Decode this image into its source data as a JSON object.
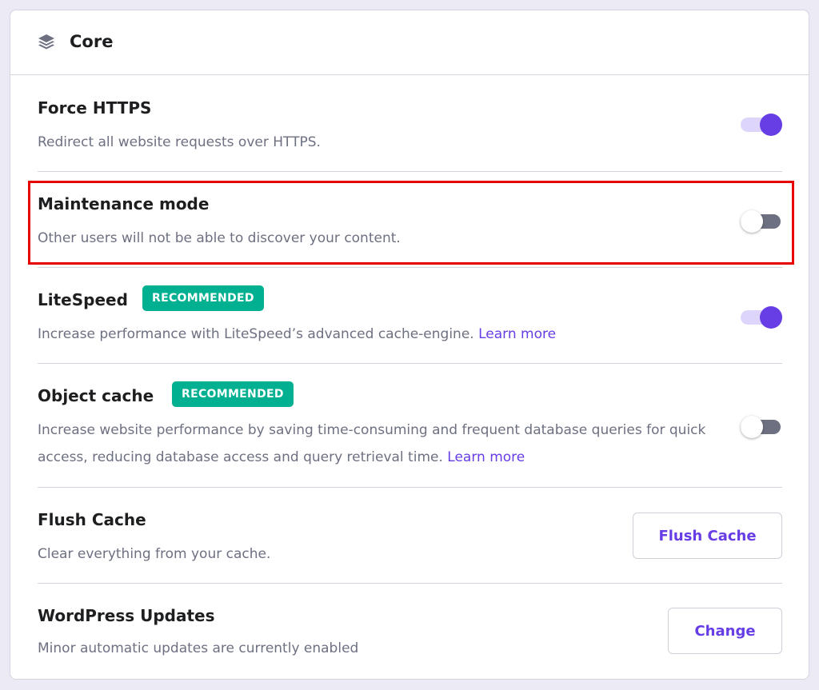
{
  "card": {
    "title": "Core",
    "icon": "layers-icon"
  },
  "settings": {
    "force_https": {
      "title": "Force HTTPS",
      "description": "Redirect all website requests over HTTPS.",
      "enabled": true
    },
    "maintenance_mode": {
      "title": "Maintenance mode",
      "description": "Other users will not be able to discover your content.",
      "enabled": false,
      "highlighted": true
    },
    "litespeed": {
      "title": "LiteSpeed",
      "badge": "RECOMMENDED",
      "description": "Increase performance with LiteSpeed’s advanced cache-engine.",
      "link": "Learn more",
      "enabled": true
    },
    "object_cache": {
      "title": "Object cache",
      "badge": "RECOMMENDED",
      "description": "Increase website performance by saving time-consuming and frequent database queries for quick access, reducing database access and query retrieval time.",
      "link": "Learn more",
      "enabled": false
    },
    "flush_cache": {
      "title": "Flush Cache",
      "description": "Clear everything from your cache.",
      "button": "Flush Cache"
    },
    "wordpress_updates": {
      "title": "WordPress Updates",
      "description": "Minor automatic updates are currently enabled",
      "button": "Change"
    }
  },
  "colors": {
    "accent": "#673de6",
    "badge": "#00b090",
    "highlight": "#e60000"
  }
}
